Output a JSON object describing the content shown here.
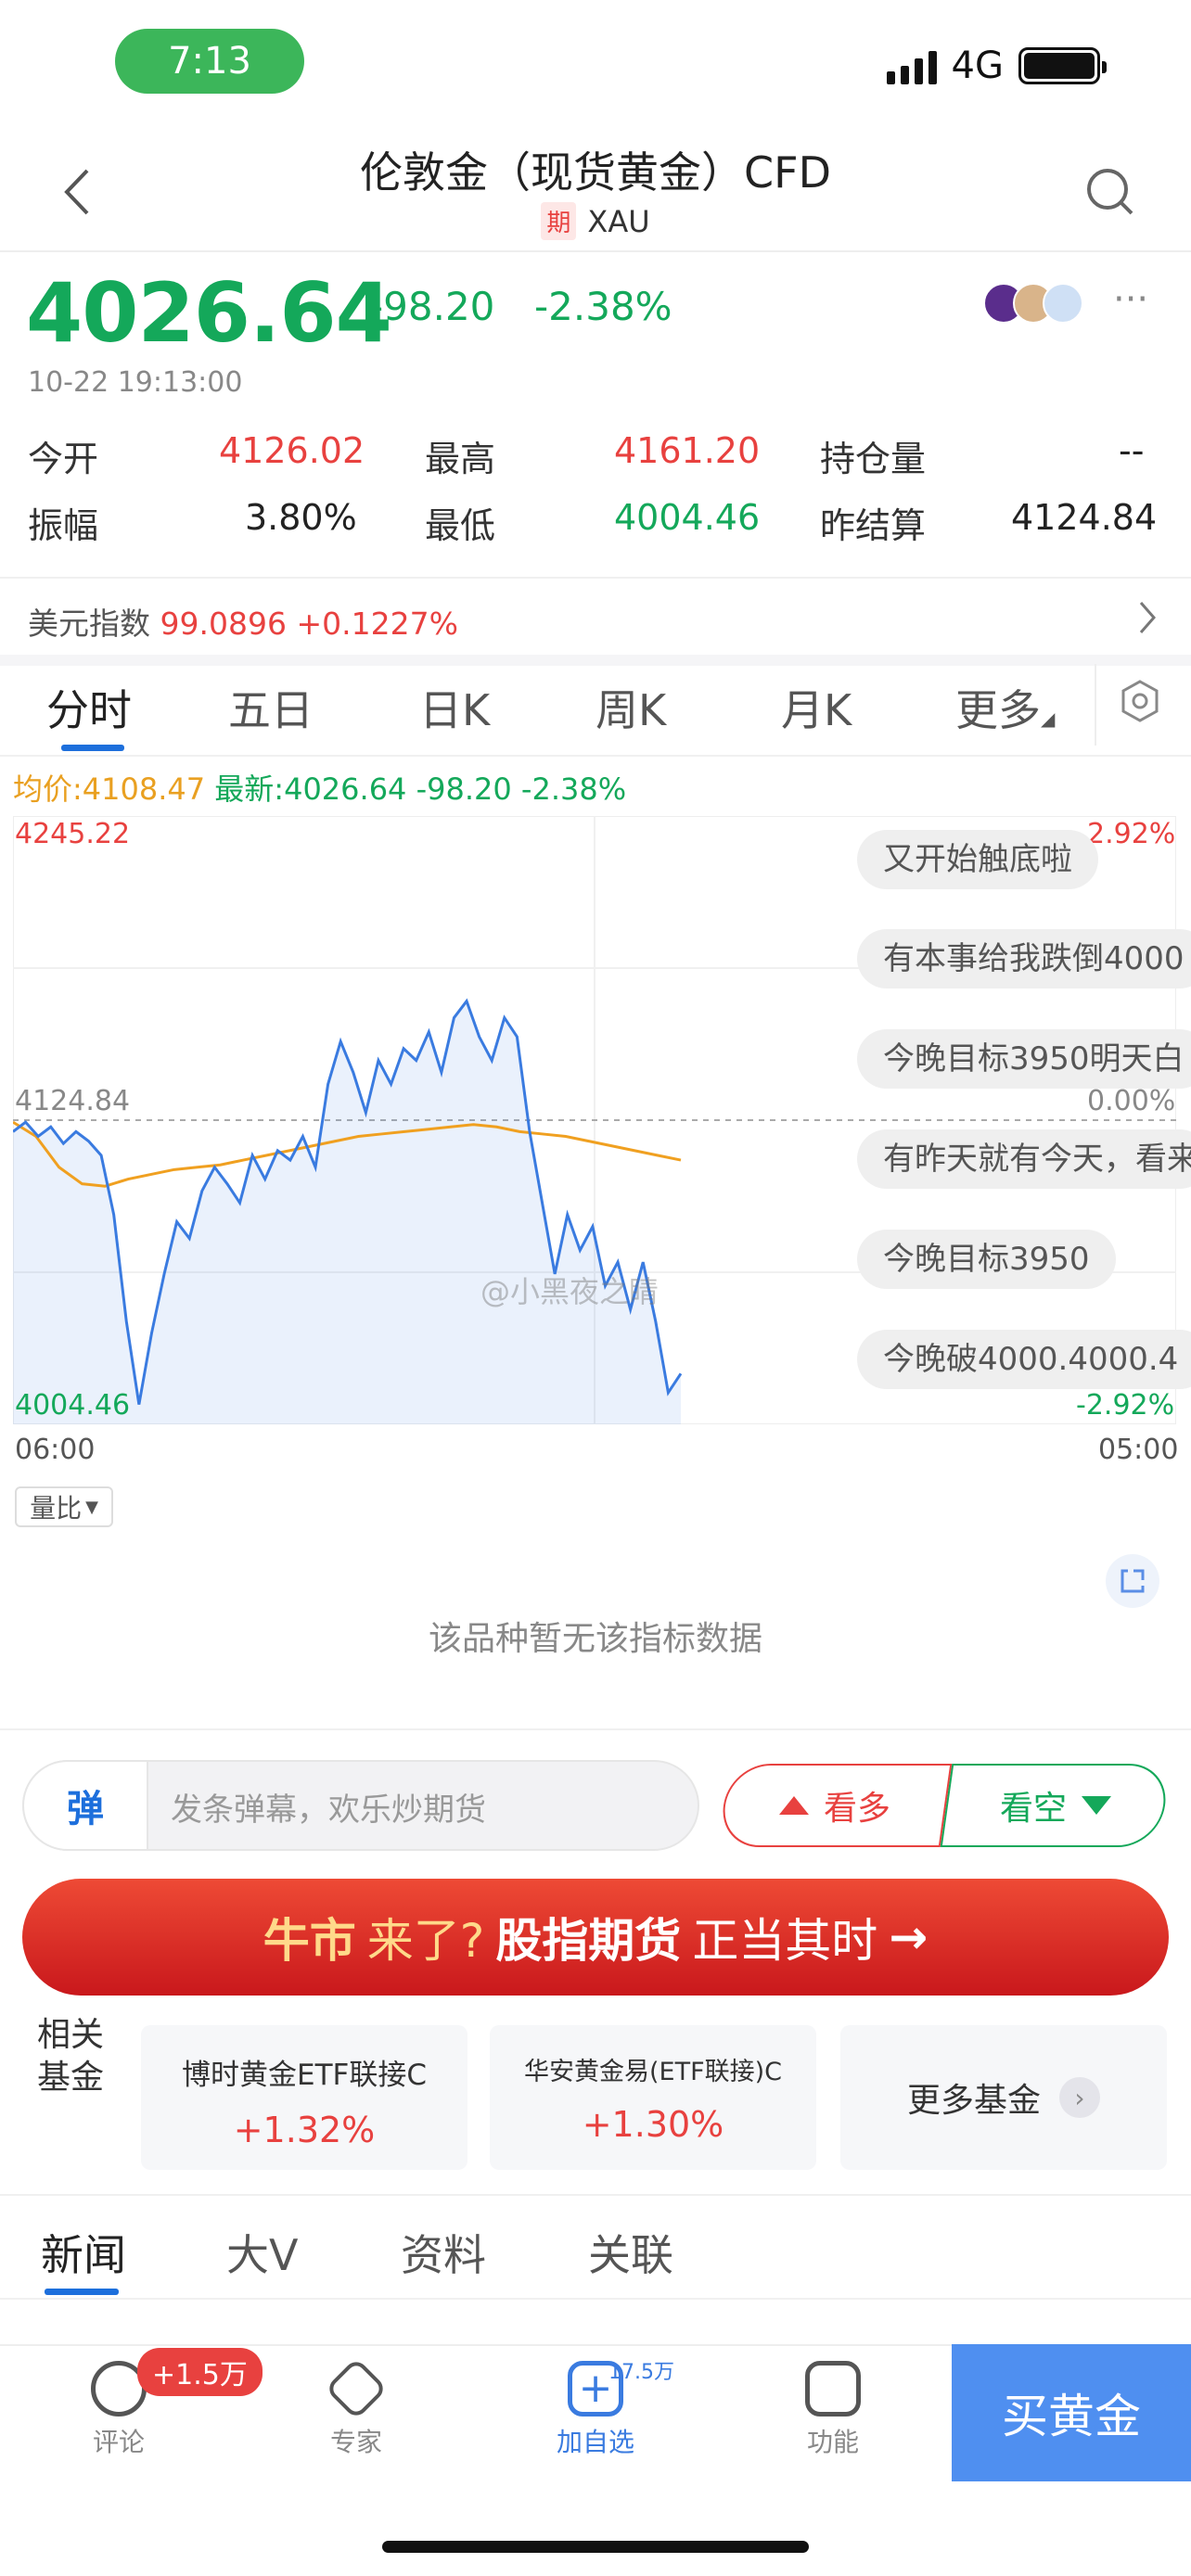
{
  "status_bar": {
    "time": "7:13",
    "network": "4G"
  },
  "header": {
    "title": "伦敦金（现货黄金）CFD",
    "tag": "期",
    "symbol": "XAU"
  },
  "quote": {
    "price": "4026.64",
    "change": "-98.20",
    "change_pct": "-2.38%",
    "datetime": "10-22 19:13:00",
    "stats": [
      {
        "label": "今开",
        "value": "4126.02",
        "color": "red"
      },
      {
        "label": "最高",
        "value": "4161.20",
        "color": "red"
      },
      {
        "label": "持仓量",
        "value": "--",
        "color": "black"
      },
      {
        "label": "振幅",
        "value": "3.80%",
        "color": "black"
      },
      {
        "label": "最低",
        "value": "4004.46",
        "color": "green"
      },
      {
        "label": "昨结算",
        "value": "4124.84",
        "color": "black"
      }
    ]
  },
  "usd_index": {
    "label": "美元指数",
    "value": "99.0896",
    "change": "+0.1227%"
  },
  "chart_tabs": [
    "分时",
    "五日",
    "日K",
    "周K",
    "月K",
    "更多"
  ],
  "legend": {
    "avg": "均价:4108.47",
    "latest": "最新:4026.64",
    "change": "-98.20",
    "change_pct": "-2.38%"
  },
  "chart_labels": {
    "y_max": "4245.22",
    "y_mid": "4124.84",
    "y_min": "4004.46",
    "pct_max": "2.92%",
    "pct_mid": "0.00%",
    "pct_min": "-2.92%",
    "x_start": "06:00",
    "x_end": "05:00"
  },
  "danmu": [
    "又开始触底啦",
    "有本事给我跌倒4000",
    "今晚目标3950明天白",
    "有昨天就有今天，看来",
    "今晚目标3950",
    "今晚破4000.4000.4"
  ],
  "watermark": "@小黑夜之睛",
  "indicator": {
    "selector": "量比",
    "empty_text": "该品种暂无该指标数据"
  },
  "actions": {
    "danmu_icon": "弹",
    "danmu_placeholder": "发条弹幕，欢乐炒期货",
    "bull": "看多",
    "bear": "看空"
  },
  "banner": {
    "part1": "牛市",
    "part2": "来了?",
    "part3": "股指期货",
    "part4": "正当其时",
    "arrow": "→"
  },
  "funds": {
    "label1": "相关",
    "label2": "基金",
    "items": [
      {
        "name": "博时黄金ETF联接C",
        "change": "+1.32%"
      },
      {
        "name": "华安黄金易(ETF联接)C",
        "change": "+1.30%"
      }
    ],
    "more": "更多基金"
  },
  "news_tabs": [
    "新闻",
    "大V",
    "资料",
    "关联"
  ],
  "bottom_nav": {
    "comment": "评论",
    "comment_badge": "+1.5万",
    "expert": "专家",
    "add_watch": "加自选",
    "add_watch_count": "17.5万",
    "function": "功能",
    "buy": "买黄金"
  },
  "chart_data": {
    "type": "line",
    "title": "",
    "xlabel": "",
    "ylabel": "",
    "x_range": [
      "06:00",
      "05:00"
    ],
    "ylim": [
      4004.46,
      4245.22
    ],
    "reference": 4124.84,
    "series": [
      {
        "values": [
          4120,
          4124,
          4118,
          4122,
          4115,
          4120,
          4116,
          4110,
          4085,
          4040,
          4005,
          4035,
          4060,
          4082,
          4075,
          4095,
          4105,
          4098,
          4090,
          4110,
          4100,
          4112,
          4108,
          4118,
          4105,
          4140,
          4158,
          4145,
          4128,
          4150,
          4140,
          4155,
          4150,
          4162,
          4145,
          4168,
          4175,
          4160,
          4150,
          4168,
          4160,
          4120,
          4090,
          4060,
          4085,
          4070,
          4080,
          4055,
          4065,
          4045,
          4065,
          4040,
          4010,
          4018
        ]
      },
      {
        "values": [
          4124,
          4118,
          4105,
          4098,
          4097,
          4100,
          4102,
          4104,
          4105,
          4106,
          4108,
          4110,
          4112,
          4114,
          4116,
          4118,
          4119,
          4120,
          4121,
          4122,
          4123,
          4122,
          4120,
          4119,
          4118,
          4116,
          4114,
          4112,
          4110,
          4108
        ]
      }
    ]
  }
}
